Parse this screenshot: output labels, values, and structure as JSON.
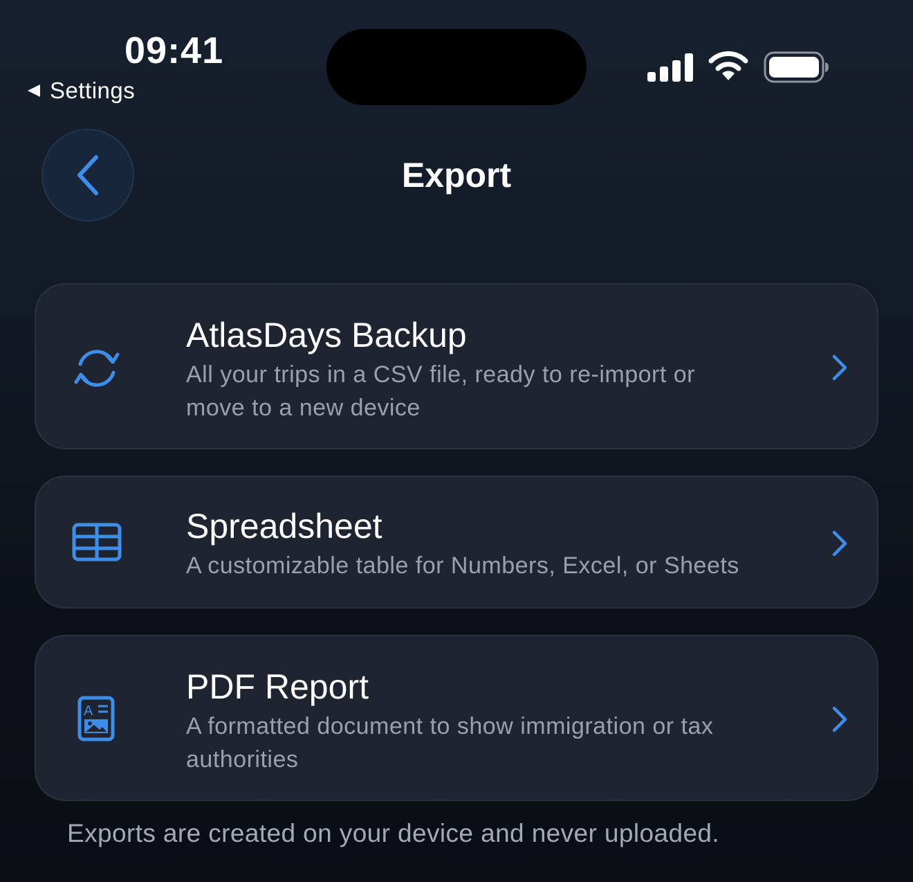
{
  "status_bar": {
    "time": "09:41",
    "back_to_app_label": "Settings",
    "signal_icon": "cellular-signal-icon",
    "wifi_icon": "wifi-icon",
    "battery_icon": "battery-full-icon"
  },
  "nav": {
    "back_icon": "chevron-left-icon",
    "title": "Export"
  },
  "colors": {
    "accent": "#3d8ee8",
    "card_bg": "#1e2430",
    "subtitle": "#9aa1ac"
  },
  "options": [
    {
      "icon": "sync-arrows-icon",
      "title": "AtlasDays Backup",
      "description_lines": [
        "All your trips in a CSV file, ready to re-import or",
        "move to a new device"
      ]
    },
    {
      "icon": "table-icon",
      "title": "Spreadsheet",
      "description_lines": [
        "A customizable table for Numbers, Excel, or Sheets"
      ]
    },
    {
      "icon": "document-report-icon",
      "title": "PDF Report",
      "description_lines": [
        "A formatted document to show immigration or tax",
        "authorities"
      ]
    }
  ],
  "footer": {
    "note": "Exports are created on your device and never uploaded."
  }
}
